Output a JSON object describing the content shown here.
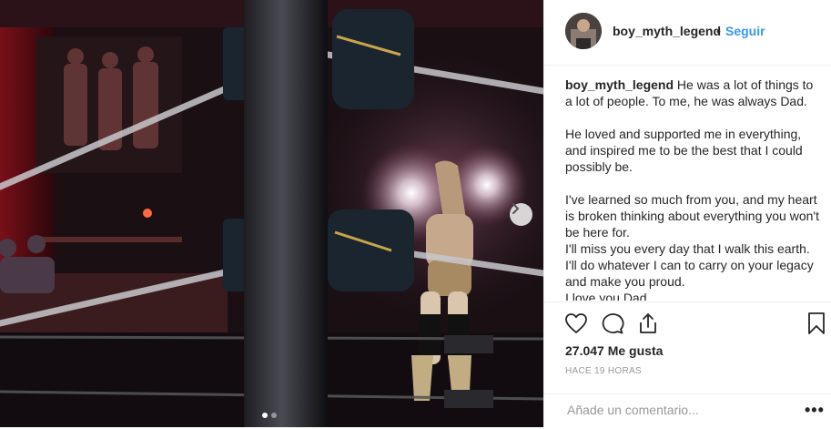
{
  "post": {
    "username": "boy_myth_legend",
    "separator": "•",
    "follow_label": "Seguir",
    "image_alt": "Wrestler standing in a ring under stage lights",
    "caption": {
      "username": "boy_myth_legend",
      "line1": "He was a lot of things to a lot of people. To me, he was always Dad.",
      "para2": "He loved and supported me in everything, and inspired me to be the best that I could possibly be.",
      "para3a": "I've learned so much from you, and my heart is broken thinking about everything you won't be here for.",
      "para3b": "I'll miss you every day that I walk this earth.",
      "para3c": "I'll do whatever I can to carry on your legacy and make you proud.",
      "para3d": "I love you Dad."
    },
    "icons": {
      "like": "heart-icon",
      "comment": "comment-icon",
      "share": "share-icon",
      "save": "bookmark-icon",
      "next": "chevron-right-icon",
      "more": "more-options-icon"
    },
    "likes_label": "27.047 Me gusta",
    "time_label": "HACE 19 HORAS",
    "comment_placeholder": "Añade un comentario...",
    "more_label": "•••",
    "carousel": {
      "total": 2,
      "active": 1
    }
  }
}
